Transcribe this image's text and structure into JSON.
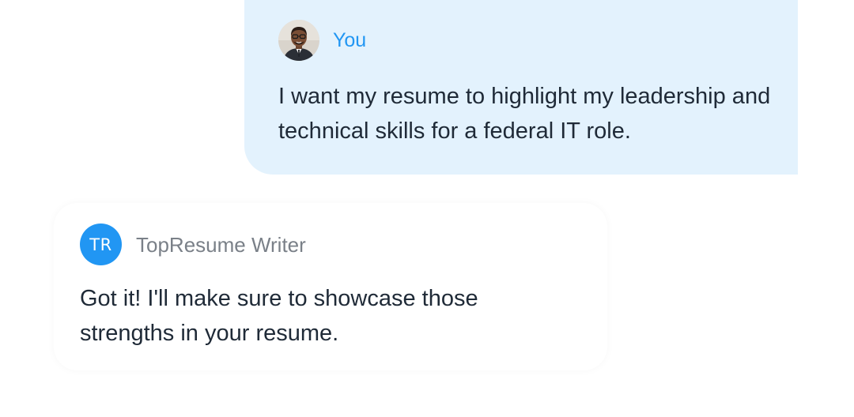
{
  "user_message": {
    "sender_name": "You",
    "text": "I want my resume to highlight my leadership and technical skills for a federal IT role."
  },
  "bot_message": {
    "avatar_initials": "TR",
    "sender_name": "TopResume Writer",
    "text": "Got it! I'll make sure to showcase those strengths in your resume."
  },
  "colors": {
    "accent_blue": "#2196f3",
    "user_bubble_bg": "#e3f2fd",
    "body_text": "#1f2a37",
    "muted_text": "#7a8088"
  }
}
